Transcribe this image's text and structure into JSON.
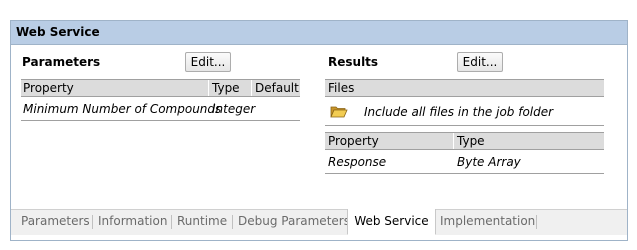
{
  "panel": {
    "title": "Web Service"
  },
  "parameters": {
    "title": "Parameters",
    "edit_label": "Edit...",
    "columns": [
      "Property",
      "Type",
      "Default"
    ],
    "rows": [
      {
        "property": "Minimum Number of Compounds",
        "type": "Integer",
        "default": ""
      }
    ]
  },
  "results": {
    "title": "Results",
    "edit_label": "Edit...",
    "files_header": "Files",
    "files_item": "Include all files in the job folder",
    "columns": [
      "Property",
      "Type"
    ],
    "rows": [
      {
        "property": "Response",
        "type": "Byte Array"
      }
    ]
  },
  "tabs": [
    {
      "label": "Parameters"
    },
    {
      "label": "Information"
    },
    {
      "label": "Runtime"
    },
    {
      "label": "Debug Parameters"
    },
    {
      "label": "Web Service",
      "active": true
    },
    {
      "label": "Implementation"
    }
  ],
  "colors": {
    "header": "#b9cde5",
    "folder": "#e3b93c"
  }
}
